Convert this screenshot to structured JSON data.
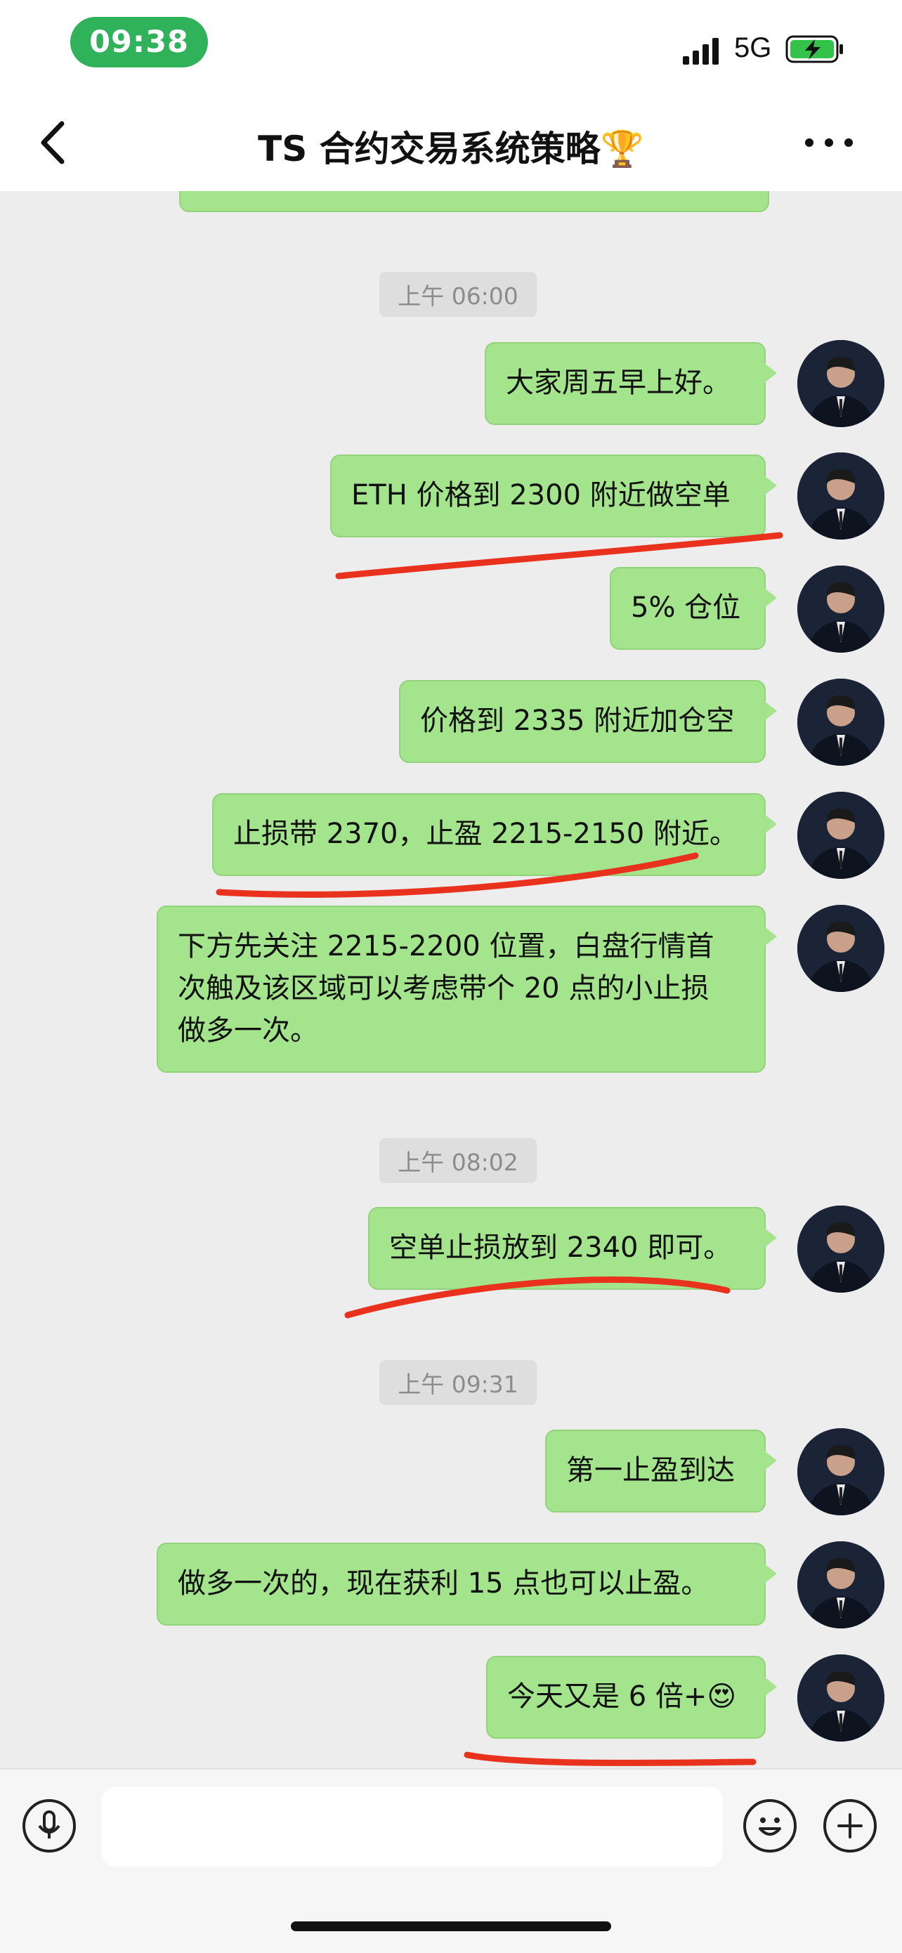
{
  "status_bar": {
    "time": "09:38",
    "network": "5G",
    "icons": [
      "signal-icon",
      "battery-charging-icon"
    ]
  },
  "header": {
    "title": "TS 合约交易系统策略🏆",
    "icons": [
      "back-icon",
      "more-icon"
    ]
  },
  "messages": [
    {
      "type": "timestamp",
      "text": "上午 06:00"
    },
    {
      "type": "outgoing",
      "text": "大家周五早上好。"
    },
    {
      "type": "outgoing",
      "text": "ETH 价格到 2300 附近做空单"
    },
    {
      "type": "outgoing",
      "text": "5% 仓位"
    },
    {
      "type": "outgoing",
      "text": "价格到 2335 附近加仓空"
    },
    {
      "type": "outgoing",
      "text": "止损带 2370，止盈 2215-2150 附近。"
    },
    {
      "type": "outgoing",
      "lines": [
        "下方先关注 2215-2200 位置，白盘行情首",
        "次触及该区域可以考虑带个 20 点的小止损",
        "做多一次。"
      ]
    },
    {
      "type": "timestamp",
      "text": "上午 08:02"
    },
    {
      "type": "outgoing",
      "text": "空单止损放到 2340 即可。"
    },
    {
      "type": "timestamp",
      "text": "上午 09:31"
    },
    {
      "type": "outgoing",
      "text": "第一止盈到达"
    },
    {
      "type": "outgoing",
      "text": "做多一次的，现在获利 15 点也可以止盈。"
    },
    {
      "type": "outgoing",
      "text": "今天又是 6 倍+😍"
    }
  ],
  "annotation_color": "#e8321e",
  "bubble_color": "#a4e48d",
  "input_bar": {
    "icons": [
      "voice-icon",
      "emoji-icon",
      "plus-icon"
    ],
    "text_value": ""
  }
}
